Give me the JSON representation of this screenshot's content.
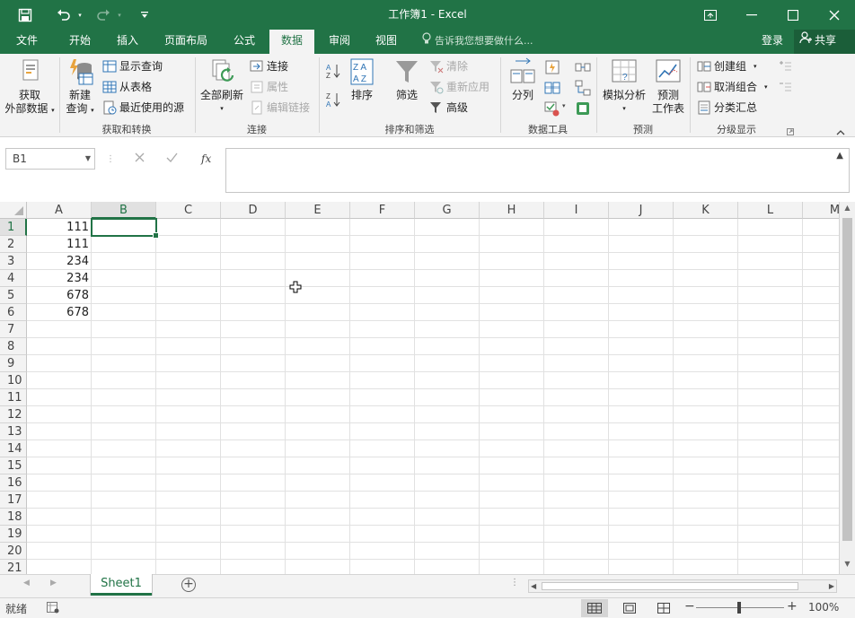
{
  "window": {
    "title": "工作簿1 - Excel"
  },
  "tabs": [
    "文件",
    "开始",
    "插入",
    "页面布局",
    "公式",
    "数据",
    "审阅",
    "视图"
  ],
  "active_tab": "数据",
  "tell_me": "告诉我您想要做什么...",
  "account": {
    "login": "登录",
    "share": "共享"
  },
  "ribbon": {
    "get_transform": {
      "label": "获取和转换",
      "get_external_line1": "获取",
      "get_external_line2": "外部数据",
      "new_query_line1": "新建",
      "new_query_line2": "查询",
      "show_queries": "显示查询",
      "from_table": "从表格",
      "recent_sources": "最近使用的源"
    },
    "connections": {
      "label": "连接",
      "refresh_all": "全部刷新",
      "connections": "连接",
      "properties": "属性",
      "edit_links": "编辑链接"
    },
    "sort_filter": {
      "label": "排序和筛选",
      "sort_az": "A→Z",
      "sort_za": "Z→A",
      "sort": "排序",
      "filter": "筛选",
      "clear": "清除",
      "reapply": "重新应用",
      "advanced": "高级"
    },
    "data_tools": {
      "label": "数据工具",
      "text_to_columns": "分列"
    },
    "forecast": {
      "label": "预测",
      "what_if": "模拟分析",
      "forecast_sheet_line1": "预测",
      "forecast_sheet_line2": "工作表"
    },
    "outline": {
      "label": "分级显示",
      "group": "创建组",
      "ungroup": "取消组合",
      "subtotal": "分类汇总"
    }
  },
  "formula_bar": {
    "name_box": "B1",
    "fx": "fx",
    "content": ""
  },
  "grid": {
    "columns": [
      "A",
      "B",
      "C",
      "D",
      "E",
      "F",
      "G",
      "H",
      "I",
      "J",
      "K",
      "L",
      "M"
    ],
    "rows": [
      "1",
      "2",
      "3",
      "4",
      "5",
      "6",
      "7",
      "8",
      "9",
      "10",
      "11",
      "12",
      "13",
      "14",
      "15",
      "16",
      "17",
      "18",
      "19",
      "20",
      "21"
    ],
    "column_a_values": [
      "111",
      "111",
      "234",
      "234",
      "678",
      "678"
    ],
    "selected_cell": "B1"
  },
  "sheets": [
    "Sheet1"
  ],
  "status": {
    "ready": "就绪",
    "zoom": "100%"
  },
  "colors": {
    "brand": "#217346",
    "ribbon_bg": "#f3f3f3"
  }
}
